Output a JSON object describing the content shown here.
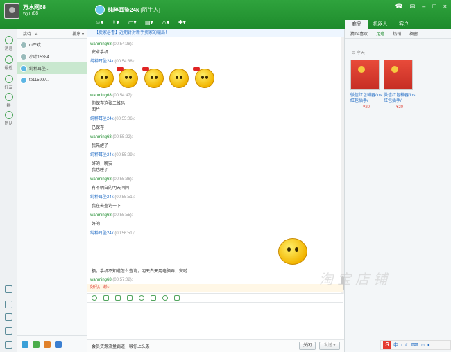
{
  "user": {
    "name": "万水网68",
    "sub": "wym68"
  },
  "chat": {
    "title": "纯粹耳坠24k",
    "tag": "[陌生人]"
  },
  "window_buttons": [
    "☎",
    "✉",
    "–",
    "□",
    "×"
  ],
  "right_tabs": [
    "商品",
    "机器人",
    "客户"
  ],
  "nav": [
    {
      "label": "消息"
    },
    {
      "label": "最近"
    },
    {
      "label": "好友"
    },
    {
      "label": "群"
    },
    {
      "label": "团队"
    }
  ],
  "contact_list": {
    "header_left": "接待：4",
    "header_right": "排序 ▾",
    "items": [
      {
        "name": "dt严欢"
      },
      {
        "name": "小叶15384..."
      },
      {
        "name": "纯粹耳坠..."
      },
      {
        "name": "tb115997..."
      }
    ]
  },
  "notice": "【卖家必看】近期针对新手卖家的骗局！",
  "messages": [
    {
      "who": "",
      "time": "",
      "lines": [
        "安卓手机"
      ]
    },
    {
      "who": "纯粹耳坠24k",
      "time": "(00:54:38):",
      "lines": []
    },
    {
      "who": "wanming68",
      "time": "(00:54:47):",
      "lines": [
        "你保存这张二维码",
        "图片"
      ]
    },
    {
      "who": "纯粹耳坠24k",
      "time": "(00:55:06):",
      "lines": [
        "已保存"
      ]
    },
    {
      "who": "wanming68",
      "time": "(00:55:22):",
      "lines": [
        "我先醒了"
      ]
    },
    {
      "who": "纯粹耳坠24k",
      "time": "(00:55:29):",
      "lines": [
        "好的，晚安",
        "我也睡了"
      ]
    },
    {
      "who": "wanming68",
      "time": "(00:55:36):",
      "lines": [
        "有不明白的明天问问"
      ]
    },
    {
      "who": "纯粹耳坠24k",
      "time": "(00:55:51):",
      "lines": [
        "我在去查询一下"
      ]
    },
    {
      "who": "wanming68",
      "time": "(00:55:55):",
      "lines": [
        "好的"
      ]
    },
    {
      "who": "纯粹耳坠24k",
      "time": "(00:56:51):",
      "lines": []
    },
    {
      "who": "",
      "time": "",
      "lines": [
        "额，手机不知道怎么查询，明天白天用电脑弄，安啦"
      ]
    },
    {
      "who": "wanming68",
      "time": "(00:57:02):",
      "lines": [
        "没事"
      ]
    }
  ],
  "first_sender": {
    "who": "wanming68",
    "time": "(00:54:28):"
  },
  "quote": "好的，谢~",
  "input_tip": "会员资源流量霸道，喊你上头条！",
  "buttons": {
    "close": "关闭",
    "send": "发送 ▾"
  },
  "right_panel": {
    "tabs": [
      "猜TA喜欢",
      "足迹",
      "热销",
      "橱窗"
    ],
    "today": "今天",
    "products": [
      {
        "name": "微信红包神器/ios红包插手/",
        "price": "¥20"
      },
      {
        "name": "微信红包神器/ios红包插手/",
        "price": "¥20"
      }
    ]
  },
  "watermark": "淘宝店铺",
  "tray": [
    "S",
    "中",
    "♪",
    "☾",
    "⌨",
    "☺",
    "♦"
  ]
}
